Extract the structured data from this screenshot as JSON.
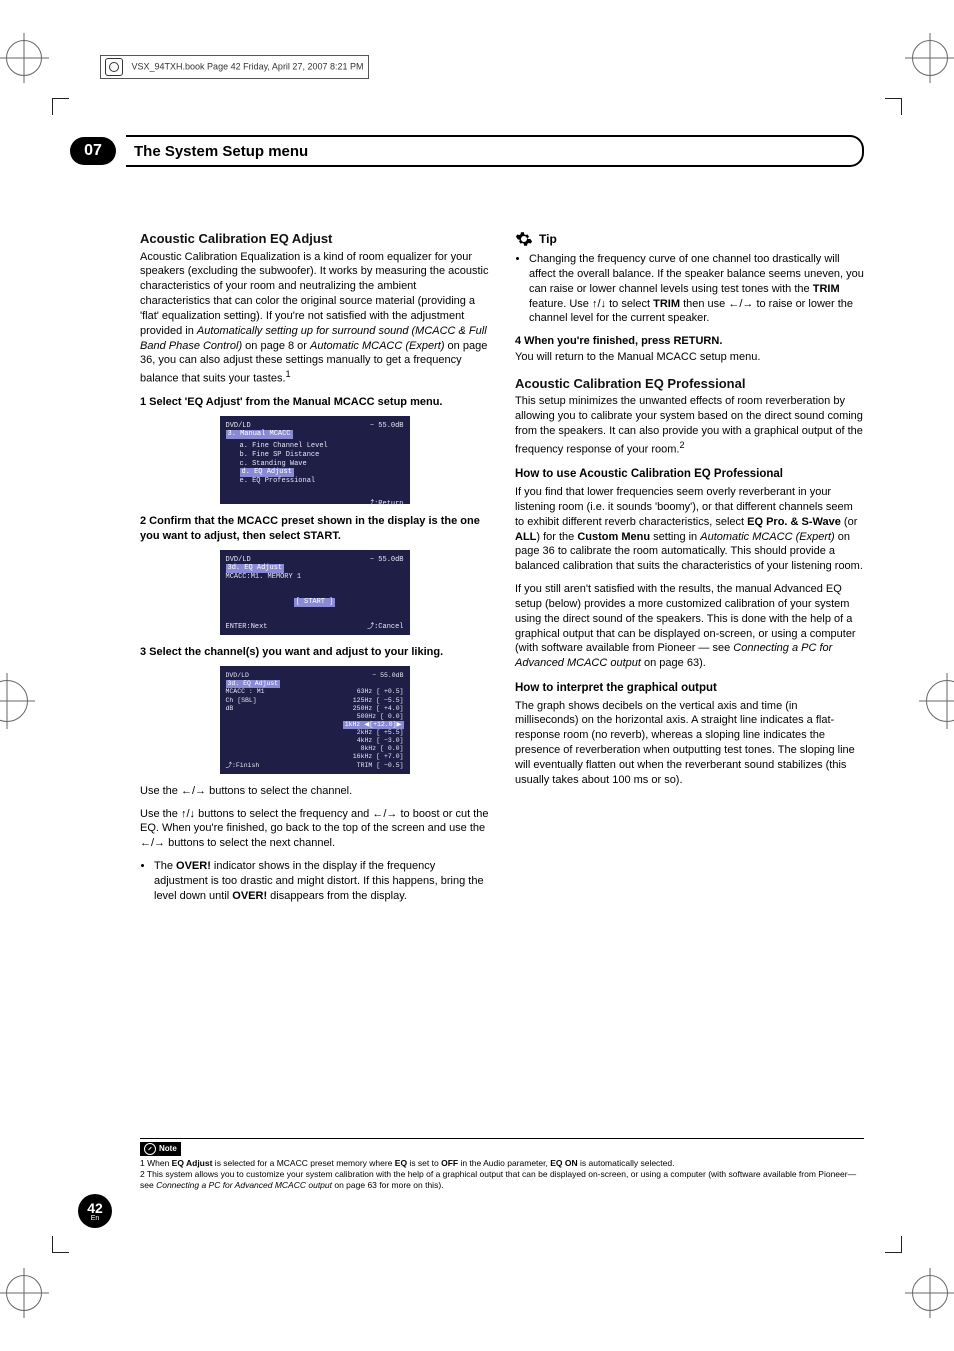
{
  "spine_header": "VSX_94TXH.book  Page 42  Friday, April 27, 2007  8:21 PM",
  "chapter": {
    "num": "07",
    "title": "The System Setup menu"
  },
  "left": {
    "h_eq_adjust": "Acoustic Calibration EQ Adjust",
    "p_eq_adjust_a": "Acoustic Calibration Equalization is a kind of room equalizer for your speakers (excluding the subwoofer). It works by measuring the acoustic characteristics of your room and neutralizing the ambient characteristics that can color the original source material (providing a 'flat' equalization setting). If you're not satisfied with the adjustment provided in ",
    "p_eq_adjust_ital1": "Automatically setting up for surround sound (MCACC & Full Band Phase Control)",
    "p_eq_adjust_b": " on page 8 or ",
    "p_eq_adjust_ital2": "Automatic MCACC (Expert)",
    "p_eq_adjust_c": " on page 36, you can also adjust these settings manually to get a frequency balance that suits your tastes.",
    "sup1": "1",
    "step1": "1   Select 'EQ Adjust' from the Manual MCACC setup menu.",
    "screen1": {
      "title_l": "DVD/LD",
      "title_r": "− 55.0dB",
      "header": "3. Manual MCACC",
      "a": "a. Fine Channel Level",
      "b": "b. Fine SP Distance",
      "c": "c. Standing Wave",
      "d": "d. EQ Adjust",
      "e": "e. EQ Professional",
      "return": "⤴:Return"
    },
    "step2": "2   Confirm that the MCACC preset shown in the display is the one you want to adjust, then select START.",
    "screen2": {
      "title_l": "DVD/LD",
      "title_r": "− 55.0dB",
      "hdr": "3d. EQ Adjust",
      "mem": "MCACC:M1. MEMORY 1",
      "start": "[ START ]",
      "foot_l": "ENTER:Next",
      "foot_r": "⤴:Cancel"
    },
    "step3": "3   Select the channel(s) you want and adjust to your liking.",
    "screen3": {
      "title_l": "DVD/LD",
      "title_r": "− 55.0dB",
      "hdr": "3d. EQ Adjust",
      "l1": "MCACC : M1",
      "l2": "Ch     [SBL]",
      "l3": "dB",
      "r1": "63Hz  [  +0.5]",
      "r2": "125Hz [  −5.5]",
      "r3": "250Hz [  +4.0]",
      "r4": "500Hz [   0.0]",
      "r5": "1kHz ◀[+12.0]▶",
      "r6": "2kHz  [  +5.5]",
      "r7": "4kHz  [  −3.0]",
      "r8": "8kHz  [   0.0]",
      "r9": "16kHz [  +7.0]",
      "r10": "TRIM  [  −0.5]",
      "foot": "⤴:Finish"
    },
    "use_lr": "Use the ←/→ buttons to select the channel.",
    "use_ud": "Use the ↑/↓ buttons to select the frequency and ←/→ to boost or cut the EQ. When you're finished, go back to the top of the screen and use the ←/→ buttons to select the next channel.",
    "over_bullet_a": "The ",
    "over_bold": "OVER!",
    "over_bullet_b": " indicator shows in the display if the frequency adjustment is too drastic and might distort. If this happens, bring the level down until ",
    "over_bullet_c": " disappears from the display."
  },
  "right": {
    "tip_label": "Tip",
    "tip_text_a": "Changing the frequency curve of one channel too drastically will affect the overall balance. If the speaker balance seems uneven, you can raise or lower channel levels using test tones with the ",
    "tip_trim": "TRIM",
    "tip_text_b": " feature. Use ↑/↓ to select ",
    "tip_text_c": " then use ←/→ to raise or lower the channel level for the current speaker.",
    "step4": "4   When you're finished, press RETURN.",
    "step4_p": "You will return to the Manual MCACC setup menu.",
    "h_eq_pro": "Acoustic Calibration EQ Professional",
    "p_eq_pro": "This setup minimizes the unwanted effects of room reverberation by allowing you to calibrate your system based on the direct sound coming from the speakers. It can also provide you with a graphical output of the frequency response of your room.",
    "sup2": "2",
    "h_howuse": "How to use Acoustic Calibration EQ Professional",
    "p_howuse_a": "If you find that lower frequencies seem overly reverberant in your listening room (i.e. it sounds 'boomy'), or that different channels seem to exhibit different reverb characteristics, select ",
    "howuse_b1": "EQ Pro. & S-Wave",
    "p_howuse_or": " (or ",
    "howuse_b2": "ALL",
    "p_howuse_b": ") for the ",
    "howuse_b3": "Custom Menu",
    "p_howuse_c": " setting in ",
    "howuse_i1": "Automatic MCACC (Expert)",
    "p_howuse_d": " on page 36 to calibrate the room automatically. This should provide a balanced calibration that suits the characteristics of your listening room.",
    "p_howuse2_a": "If you still aren't satisfied with the results, the manual Advanced EQ setup (below) provides a more customized calibration of your system using the direct sound of the speakers. This is done with the help of a graphical output that can be displayed on-screen, or using a computer (with software available from Pioneer — see ",
    "howuse2_i": "Connecting a PC for Advanced MCACC output",
    "p_howuse2_b": " on page 63).",
    "h_interpret": "How to interpret the graphical output",
    "p_interpret": "The graph shows decibels on the vertical axis and time (in milliseconds) on the horizontal axis. A straight line indicates a flat-response room (no reverb), whereas a sloping line indicates the presence of reverberation when outputting test tones. The sloping line will eventually flatten out when the reverberant sound stabilizes (this usually takes about 100 ms or so)."
  },
  "note": {
    "label": "Note",
    "n1_a": "1 When ",
    "n1_b1": "EQ Adjust",
    "n1_b": " is selected for a MCACC preset memory where ",
    "n1_b2": "EQ",
    "n1_c": " is set to ",
    "n1_b3": "OFF",
    "n1_d": " in the Audio parameter, ",
    "n1_b4": "EQ ON",
    "n1_e": " is automatically selected.",
    "n2_a": "2 This system allows you to customize your system calibration with the help of a graphical output that can be displayed on-screen, or using a computer (with software available from Pioneer—see ",
    "n2_i": "Connecting a PC for Advanced MCACC output",
    "n2_b": " on page 63 for more on this)."
  },
  "pagefoot": {
    "num": "42",
    "lang": "En"
  }
}
